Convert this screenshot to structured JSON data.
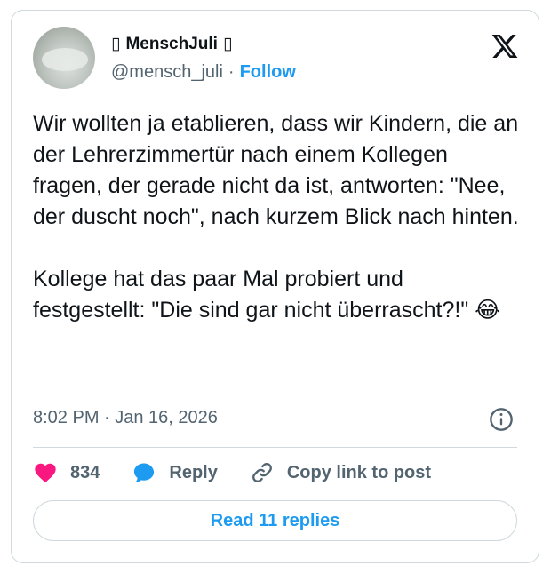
{
  "author": {
    "name": "MenschJuli",
    "name_prefix_glyph": "▯",
    "name_suffix_glyph": "▯",
    "handle": "@mensch_juli",
    "separator": "·",
    "follow_label": "Follow"
  },
  "tweet": {
    "paragraph_1": "Wir wollten ja etablieren, dass wir Kindern, die an der Lehrerzimmertür nach einem Kollegen fragen, der gerade nicht da ist, antworten: \"Nee, der duscht noch\", nach kurzem Blick nach hinten.",
    "paragraph_2": "Kollege hat das paar Mal probiert und festgestellt: \"Die sind gar nicht überrascht?!\" 😂",
    "timestamp": "8:02 PM · Jan 16, 2026"
  },
  "actions": {
    "likes_count": "834",
    "reply_label": "Reply",
    "copy_link_label": "Copy link to post"
  },
  "footer": {
    "read_replies_label": "Read 11 replies"
  },
  "icons": {
    "platform": "x-logo-icon",
    "info": "info-icon",
    "like": "heart-icon",
    "reply": "speech-bubble-icon",
    "copy_link": "link-icon"
  },
  "colors": {
    "accent": "#1d9bf0",
    "heart": "#f91880",
    "text": "#0f1419",
    "muted": "#536471",
    "border": "#cfd9de"
  }
}
